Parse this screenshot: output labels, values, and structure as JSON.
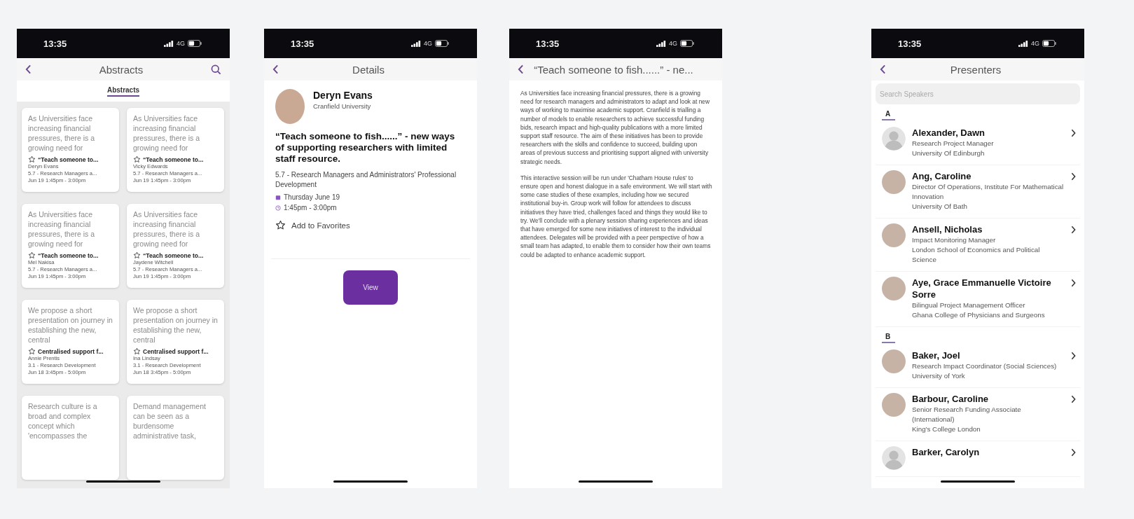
{
  "phones": [
    {
      "kind": "abstracts",
      "status": {
        "time": "13:35",
        "network": "4G"
      },
      "nav": {
        "title": "Abstracts"
      },
      "tabs": [
        {
          "label": "Abstracts",
          "selected": true
        }
      ],
      "cards": [
        {
          "preview": "As Universities face increasing financial pressures, there is a growing need for",
          "favorite": false,
          "title": "“Teach someone to...",
          "author": "Deryn Evans",
          "session": "5.7 - Research Managers a...",
          "datetime": "Jun 19 1:45pm - 3:00pm"
        },
        {
          "preview": "As Universities face increasing financial pressures, there is a growing need for",
          "favorite": false,
          "title": "“Teach someone to...",
          "author": "Vicky Edwards",
          "session": "5.7 - Research Managers a...",
          "datetime": "Jun 19 1:45pm - 3:00pm"
        },
        {
          "preview": "As Universities face increasing financial pressures, there is a growing need for",
          "favorite": false,
          "title": "“Teach someone to...",
          "author": "Mel Nakisa",
          "session": "5.7 - Research Managers a...",
          "datetime": "Jun 19 1:45pm - 3:00pm"
        },
        {
          "preview": "As Universities face increasing financial pressures, there is a growing need for",
          "favorite": false,
          "title": "“Teach someone to...",
          "author": "Jaydene Witchell",
          "session": "5.7 - Research Managers a...",
          "datetime": "Jun 19 1:45pm - 3:00pm"
        },
        {
          "preview": "We propose a short presentation on journey in establishing the new, central",
          "favorite": false,
          "title": "Centralised support f...",
          "author": "Annie Prentis",
          "session": "3.1 - Research Development",
          "datetime": "Jun 18 3:45pm - 5:00pm"
        },
        {
          "preview": "We propose a short presentation on journey in establishing the new, central",
          "favorite": false,
          "title": "Centralised support f...",
          "author": "Ina Lindsay",
          "session": "3.1 - Research Development",
          "datetime": "Jun 18 3:45pm - 5:00pm"
        },
        {
          "preview": "Research culture is a broad and complex concept which 'encompasses the"
        },
        {
          "preview": "Demand management can be seen as a burdensome administrative task,"
        }
      ]
    },
    {
      "kind": "details",
      "status": {
        "time": "13:35",
        "network": "4G"
      },
      "nav": {
        "title": "Details"
      },
      "presenter": {
        "name": "Deryn Evans",
        "affiliation": "Cranfield University"
      },
      "title": "“Teach someone to fish......” - new ways of supporting researchers with limited staff resource.",
      "session": "5.7 - Research Managers and Administrators' Professional Development",
      "date": "Thursday June 19",
      "time": "1:45pm - 3:00pm",
      "favorite": {
        "label": "Add to Favorites",
        "on": false
      },
      "button": "View"
    },
    {
      "kind": "abstract_text",
      "status": {
        "time": "13:35",
        "network": "4G"
      },
      "nav": {
        "title": "“Teach someone to fish......” - ne..."
      },
      "paragraphs": [
        "As Universities face increasing financial pressures, there is a growing need for research managers and administrators to adapt and look at new ways of working to maximise academic support. Cranfield is trialling a number of models to enable researchers to achieve successful funding bids, research impact and high-quality publications with a more limited support staff resource. The aim of these initiatives has been to provide researchers with the skills and confidence to succeed, building upon areas of previous success and prioritising support aligned with university strategic needs.",
        "This interactive session will be run under 'Chatham House rules' to ensure open and honest dialogue in a safe environment. We will start with some case studies of these examples, including how we secured institutional buy-in. Group work will follow for attendees to discuss initiatives they have tried, challenges faced and things they would like to try. We'll conclude with a plenary session sharing experiences and ideas that have emerged for some new initiatives of interest to the individual attendees. Delegates will be provided with a peer perspective of how a small team has adapted, to enable them to consider how their own teams could be adapted to enhance academic support."
      ]
    },
    {
      "kind": "presenters",
      "status": {
        "time": "13:35",
        "network": "4G"
      },
      "nav": {
        "title": "Presenters"
      },
      "search": {
        "placeholder": "Search Speakers"
      },
      "sections": [
        {
          "letter": "A",
          "people": [
            {
              "has_photo": false,
              "name": "Alexander, Dawn",
              "details": [
                "Research Project Manager",
                "University Of Edinburgh"
              ]
            },
            {
              "has_photo": true,
              "name": "Ang, Caroline",
              "details": [
                "Director Of Operations, Institute For Mathematical Innovation",
                "University Of Bath"
              ]
            },
            {
              "has_photo": true,
              "name": "Ansell, Nicholas",
              "details": [
                "Impact Monitoring Manager",
                "London School of Economics and Political Science"
              ]
            },
            {
              "has_photo": true,
              "name": "Aye, Grace Emmanuelle Victoire Sorre",
              "details": [
                "Bilingual Project Management Officer",
                "Ghana College of Physicians and Surgeons"
              ]
            }
          ]
        },
        {
          "letter": "B",
          "people": [
            {
              "has_photo": true,
              "name": "Baker, Joel",
              "details": [
                "Research Impact Coordinator (Social Sciences)",
                "University of York"
              ]
            },
            {
              "has_photo": true,
              "name": "Barbour, Caroline",
              "details": [
                "Senior Research Funding Associate (International)",
                "King's College London"
              ]
            },
            {
              "has_photo": false,
              "name": "Barker, Carolyn"
            }
          ]
        }
      ]
    }
  ]
}
